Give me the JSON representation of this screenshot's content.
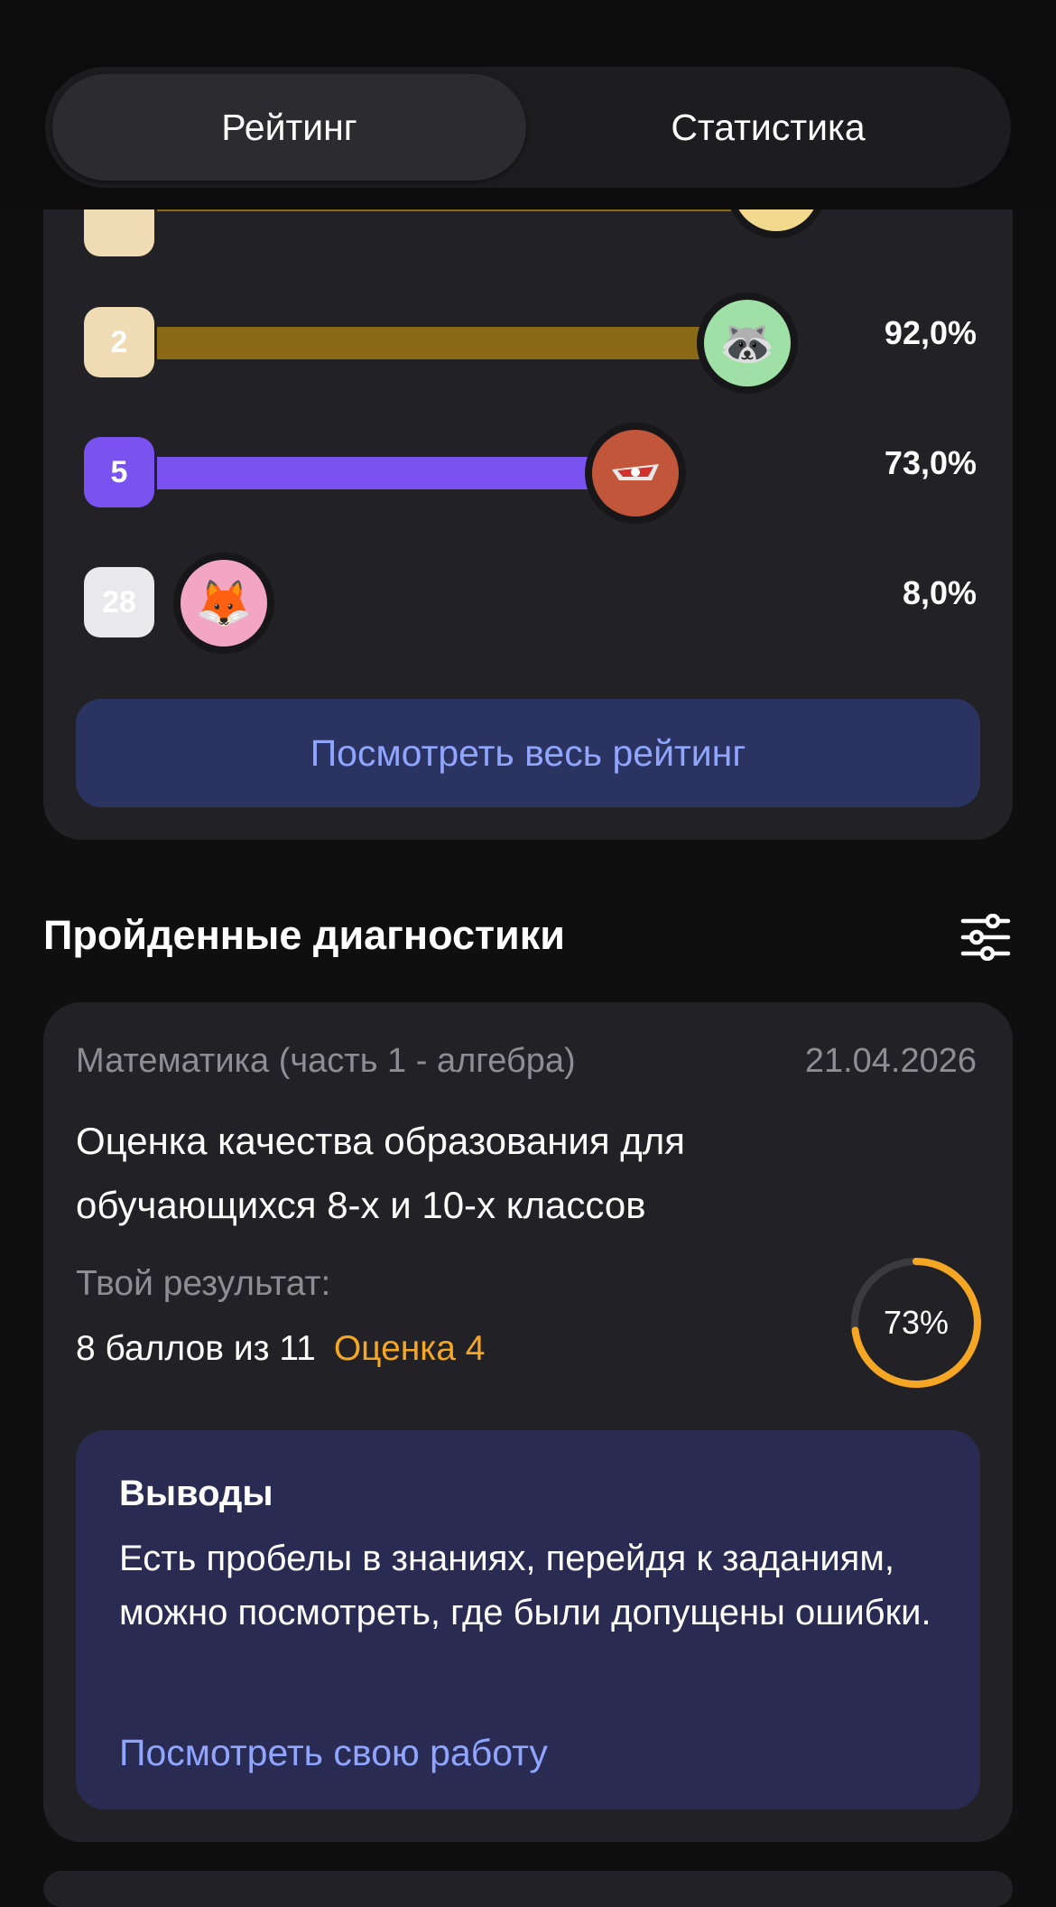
{
  "tabs": [
    {
      "label": "Рейтинг",
      "active": true
    },
    {
      "label": "Статистика",
      "active": false
    }
  ],
  "ranking": {
    "rows": [
      {
        "place": "",
        "percent": "",
        "percent_value": 100.0,
        "avatar_icon": "cat-face-icon",
        "badge_color": "#efdcb4",
        "bar_color": "#8a6a14"
      },
      {
        "place": "2",
        "percent": "92,0%",
        "percent_value": 92.0,
        "avatar_icon": "raccoon-icon",
        "badge_color": "#efdcb4",
        "bar_color": "#8a6a14"
      },
      {
        "place": "5",
        "percent": "73,0%",
        "percent_value": 73.0,
        "avatar_icon": "spartak-logo-icon",
        "badge_color": "#7a52f0",
        "bar_color": "#7a52f0"
      },
      {
        "place": "28",
        "percent": "8,0%",
        "percent_value": 8.0,
        "avatar_icon": "fox-icon",
        "badge_color": "#e9e9ec",
        "bar_color": ""
      }
    ],
    "view_all_label": "Посмотреть весь рейтинг"
  },
  "diagnostics": {
    "section_title": "Пройденные диагностики",
    "filter_icon": "sliders-icon",
    "card": {
      "subject": "Математика (часть 1 - алгебра)",
      "date": "21.04.2026",
      "title": "Оценка качества образования для обучающихся 8-х и 10-х классов",
      "result_label": "Твой результат:",
      "score": "8 баллов из 11",
      "grade": "Оценка 4",
      "percent": "73%",
      "percent_value": 73,
      "ring_color": "#f5a623",
      "conclusion": {
        "title": "Выводы",
        "text": "Есть пробелы в знаниях, перейдя к заданиям, можно посмотреть, где были допущены ошибки.",
        "link": "Посмотреть свою работу"
      }
    }
  },
  "colors": {
    "accent_link": "#8fa5ff",
    "grade": "#f5a623",
    "card_bg": "#222226"
  }
}
